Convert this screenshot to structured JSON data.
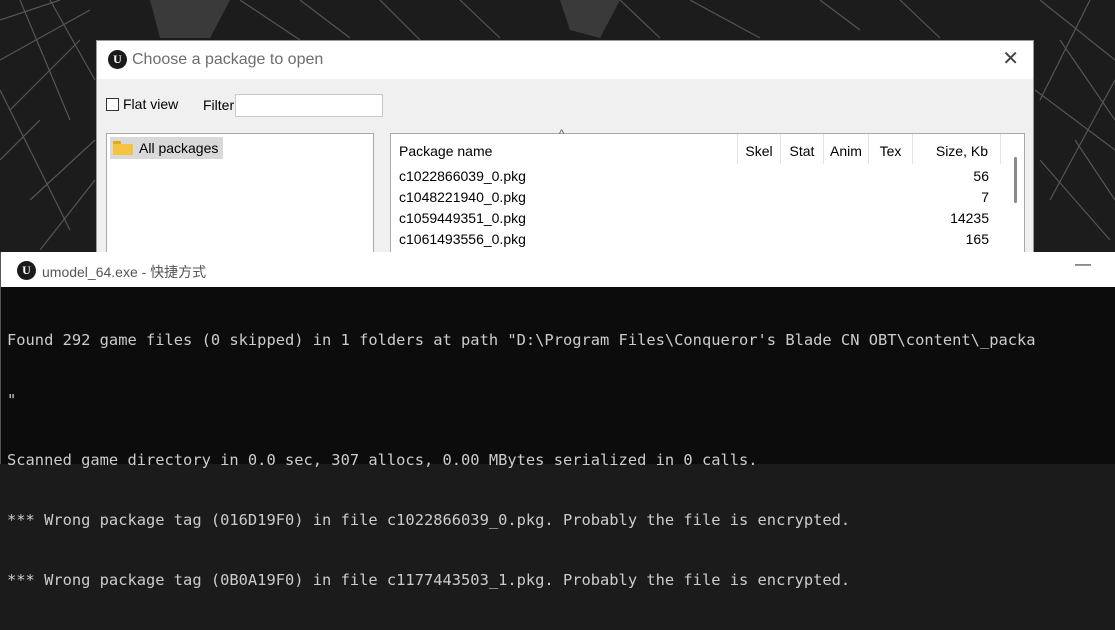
{
  "dialog": {
    "title": "Choose a package to open",
    "close_glyph": "✕",
    "flat_view_label": "Flat view",
    "flat_view_checked": false,
    "filter_label": "Filter:",
    "filter_value": "",
    "tree": {
      "items": [
        {
          "label": "All packages",
          "icon": "folder-icon",
          "selected": true
        }
      ]
    },
    "list": {
      "columns": [
        "Package name",
        "Skel",
        "Stat",
        "Anim",
        "Tex",
        "Size, Kb"
      ],
      "sort_indicator": "^",
      "rows": [
        {
          "name": "c1022866039_0.pkg",
          "size": "56"
        },
        {
          "name": "c1048221940_0.pkg",
          "size": "7"
        },
        {
          "name": "c1059449351_0.pkg",
          "size": "14235"
        },
        {
          "name": "c1061493556_0.pkg",
          "size": "165"
        }
      ]
    }
  },
  "console": {
    "title": "umodel_64.exe - 快捷方式",
    "minimize_glyph": "—",
    "lines": [
      "Found 292 game files (0 skipped) in 1 folders at path \"D:\\Program Files\\Conqueror's Blade CN OBT\\content\\_packa",
      "\"",
      "Scanned game directory in 0.0 sec, 307 allocs, 0.00 MBytes serialized in 0 calls.",
      "*** Wrong package tag (016D19F0) in file c1022866039_0.pkg. Probably the file is encrypted.",
      "*** Wrong package tag (0B0A19F0) in file c1177443503_1.pkg. Probably the file is encrypted."
    ]
  },
  "app_logo_glyph": "U",
  "colors": {
    "console_bg": "#0c0c0c",
    "console_text": "#cccccc",
    "folder": "#f5c342"
  }
}
